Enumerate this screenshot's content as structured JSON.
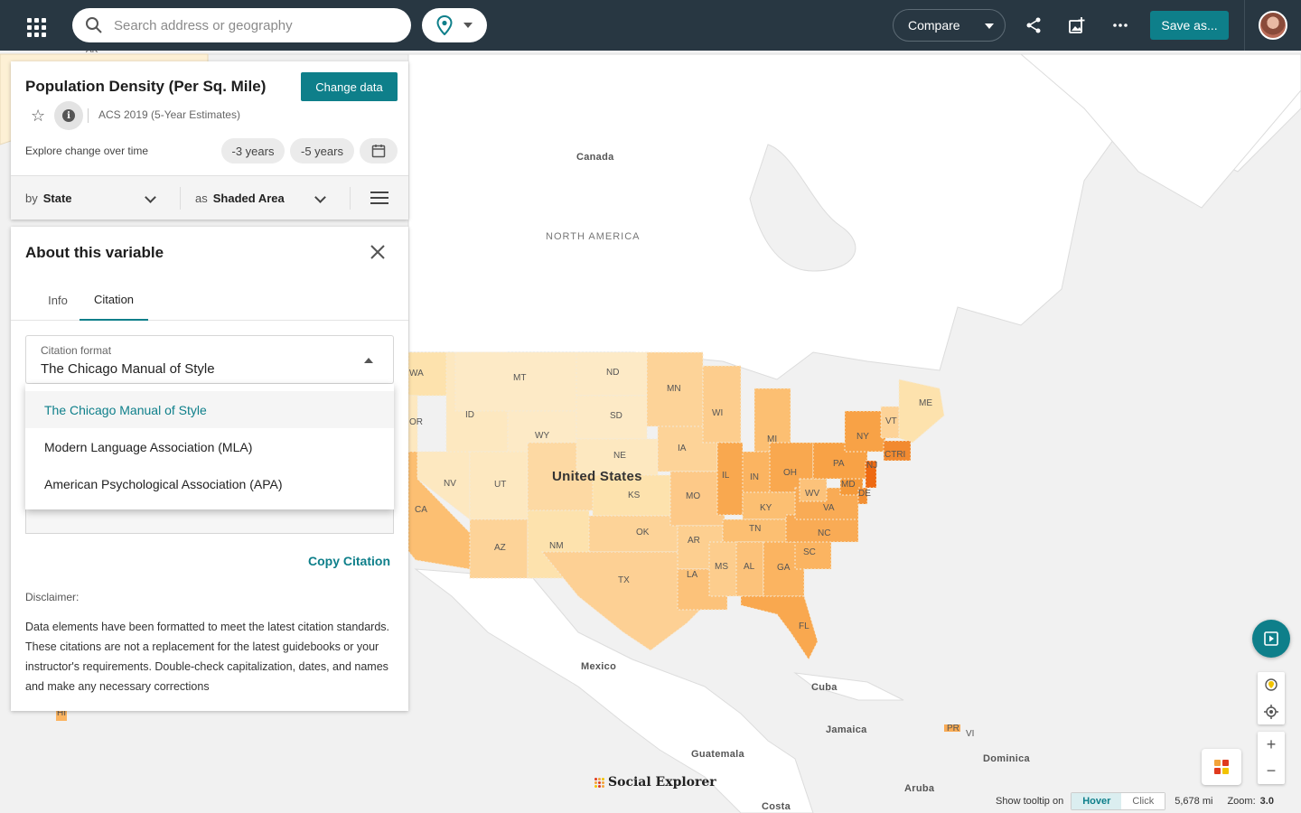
{
  "topbar": {
    "search_placeholder": "Search address or geography",
    "compare_label": "Compare",
    "save_label": "Save as..."
  },
  "data_panel": {
    "title": "Population Density (Per Sq. Mile)",
    "change_data_label": "Change data",
    "survey": "ACS 2019 (5-Year Estimates)",
    "explore_label": "Explore change over time",
    "pill_3": "-3 years",
    "pill_5": "-5 years",
    "by_prefix": "by",
    "by_value": "State",
    "as_prefix": "as",
    "as_value": "Shaded Area"
  },
  "about": {
    "heading": "About this variable",
    "tabs": [
      "Info",
      "Citation"
    ],
    "active_tab": "Citation",
    "citation_format_label": "Citation format",
    "citation_format_value": "The Chicago Manual of Style",
    "options": [
      "The Chicago Manual of Style",
      "Modern Language Association (MLA)",
      "American Psychological Association (APA)"
    ],
    "copy_label": "Copy Citation",
    "disclaimer_heading": "Disclaimer:",
    "disclaimer_text": "Data elements have been formatted to meet the latest citation standards. These citations are not a replacement for the latest guidebooks or your instructor's requirements. Double-check capitalization, dates, and names and make any necessary corrections"
  },
  "map": {
    "labels": {
      "canada": "Canada",
      "north_america": "NORTH AMERICA",
      "us": "United States",
      "mexico": "Mexico",
      "cuba": "Cuba",
      "jamaica": "Jamaica",
      "guatemala": "Guatemala",
      "dominica": "Dominica",
      "aruba": "Aruba",
      "costa": "Costa",
      "ak": "AK",
      "hi": "HI",
      "pr": "PR",
      "vi": "VI"
    },
    "states": {
      "wa": "WA",
      "or": "OR",
      "ca": "CA",
      "nv": "NV",
      "id": "ID",
      "mt": "MT",
      "wy": "WY",
      "ut": "UT",
      "az": "AZ",
      "nm": "NM",
      "nd": "ND",
      "sd": "SD",
      "ne": "NE",
      "ks": "KS",
      "ok": "OK",
      "tx": "TX",
      "mn": "MN",
      "ia": "IA",
      "mo": "MO",
      "ar": "AR",
      "la": "LA",
      "wi": "WI",
      "il": "IL",
      "mi": "MI",
      "in": "IN",
      "oh": "OH",
      "ky": "KY",
      "tn": "TN",
      "ms": "MS",
      "al": "AL",
      "ga": "GA",
      "fl": "FL",
      "sc": "SC",
      "nc": "NC",
      "va": "VA",
      "wv": "WV",
      "pa": "PA",
      "ny": "NY",
      "vt": "VT",
      "me": "ME",
      "md": "MD",
      "de": "DE",
      "nj": "NJ",
      "ctri": "CTRI"
    }
  },
  "footer": {
    "brand": "Social Explorer",
    "tooltip_label": "Show tooltip on",
    "hover": "Hover",
    "click": "Click",
    "scale": "5,678 mi",
    "zoom_label": "Zoom:",
    "zoom_value": "3.0"
  },
  "colors": {
    "accent": "#0e7f8a",
    "topbar": "#283742",
    "density_low": "#fde8c0",
    "density_mid": "#fcc97f",
    "density_high": "#f59a3a",
    "density_max": "#ee6a12"
  }
}
